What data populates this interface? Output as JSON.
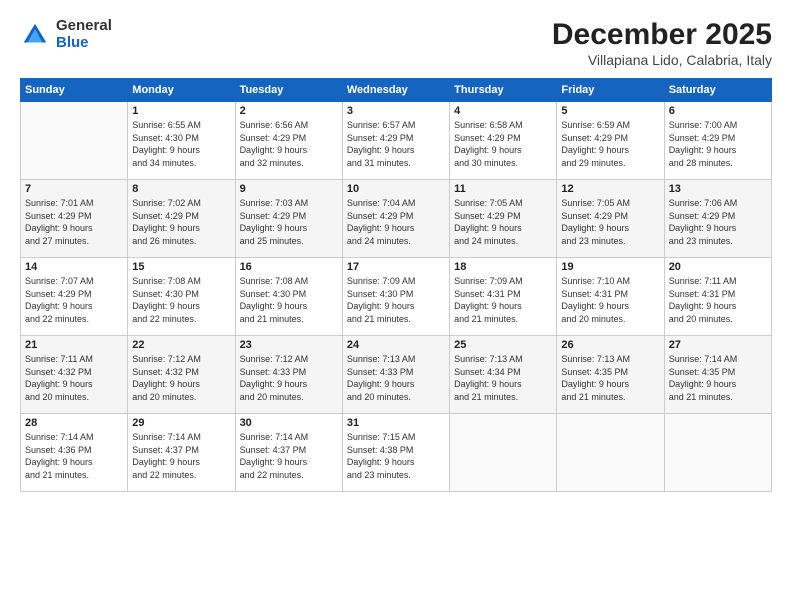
{
  "logo": {
    "general": "General",
    "blue": "Blue"
  },
  "title": "December 2025",
  "location": "Villapiana Lido, Calabria, Italy",
  "days_of_week": [
    "Sunday",
    "Monday",
    "Tuesday",
    "Wednesday",
    "Thursday",
    "Friday",
    "Saturday"
  ],
  "weeks": [
    [
      {
        "day": "",
        "sunrise": "",
        "sunset": "",
        "daylight": ""
      },
      {
        "day": "1",
        "sunrise": "Sunrise: 6:55 AM",
        "sunset": "Sunset: 4:30 PM",
        "daylight": "Daylight: 9 hours and 34 minutes."
      },
      {
        "day": "2",
        "sunrise": "Sunrise: 6:56 AM",
        "sunset": "Sunset: 4:29 PM",
        "daylight": "Daylight: 9 hours and 32 minutes."
      },
      {
        "day": "3",
        "sunrise": "Sunrise: 6:57 AM",
        "sunset": "Sunset: 4:29 PM",
        "daylight": "Daylight: 9 hours and 31 minutes."
      },
      {
        "day": "4",
        "sunrise": "Sunrise: 6:58 AM",
        "sunset": "Sunset: 4:29 PM",
        "daylight": "Daylight: 9 hours and 30 minutes."
      },
      {
        "day": "5",
        "sunrise": "Sunrise: 6:59 AM",
        "sunset": "Sunset: 4:29 PM",
        "daylight": "Daylight: 9 hours and 29 minutes."
      },
      {
        "day": "6",
        "sunrise": "Sunrise: 7:00 AM",
        "sunset": "Sunset: 4:29 PM",
        "daylight": "Daylight: 9 hours and 28 minutes."
      }
    ],
    [
      {
        "day": "7",
        "sunrise": "Sunrise: 7:01 AM",
        "sunset": "Sunset: 4:29 PM",
        "daylight": "Daylight: 9 hours and 27 minutes."
      },
      {
        "day": "8",
        "sunrise": "Sunrise: 7:02 AM",
        "sunset": "Sunset: 4:29 PM",
        "daylight": "Daylight: 9 hours and 26 minutes."
      },
      {
        "day": "9",
        "sunrise": "Sunrise: 7:03 AM",
        "sunset": "Sunset: 4:29 PM",
        "daylight": "Daylight: 9 hours and 25 minutes."
      },
      {
        "day": "10",
        "sunrise": "Sunrise: 7:04 AM",
        "sunset": "Sunset: 4:29 PM",
        "daylight": "Daylight: 9 hours and 24 minutes."
      },
      {
        "day": "11",
        "sunrise": "Sunrise: 7:05 AM",
        "sunset": "Sunset: 4:29 PM",
        "daylight": "Daylight: 9 hours and 24 minutes."
      },
      {
        "day": "12",
        "sunrise": "Sunrise: 7:05 AM",
        "sunset": "Sunset: 4:29 PM",
        "daylight": "Daylight: 9 hours and 23 minutes."
      },
      {
        "day": "13",
        "sunrise": "Sunrise: 7:06 AM",
        "sunset": "Sunset: 4:29 PM",
        "daylight": "Daylight: 9 hours and 23 minutes."
      }
    ],
    [
      {
        "day": "14",
        "sunrise": "Sunrise: 7:07 AM",
        "sunset": "Sunset: 4:29 PM",
        "daylight": "Daylight: 9 hours and 22 minutes."
      },
      {
        "day": "15",
        "sunrise": "Sunrise: 7:08 AM",
        "sunset": "Sunset: 4:30 PM",
        "daylight": "Daylight: 9 hours and 22 minutes."
      },
      {
        "day": "16",
        "sunrise": "Sunrise: 7:08 AM",
        "sunset": "Sunset: 4:30 PM",
        "daylight": "Daylight: 9 hours and 21 minutes."
      },
      {
        "day": "17",
        "sunrise": "Sunrise: 7:09 AM",
        "sunset": "Sunset: 4:30 PM",
        "daylight": "Daylight: 9 hours and 21 minutes."
      },
      {
        "day": "18",
        "sunrise": "Sunrise: 7:09 AM",
        "sunset": "Sunset: 4:31 PM",
        "daylight": "Daylight: 9 hours and 21 minutes."
      },
      {
        "day": "19",
        "sunrise": "Sunrise: 7:10 AM",
        "sunset": "Sunset: 4:31 PM",
        "daylight": "Daylight: 9 hours and 20 minutes."
      },
      {
        "day": "20",
        "sunrise": "Sunrise: 7:11 AM",
        "sunset": "Sunset: 4:31 PM",
        "daylight": "Daylight: 9 hours and 20 minutes."
      }
    ],
    [
      {
        "day": "21",
        "sunrise": "Sunrise: 7:11 AM",
        "sunset": "Sunset: 4:32 PM",
        "daylight": "Daylight: 9 hours and 20 minutes."
      },
      {
        "day": "22",
        "sunrise": "Sunrise: 7:12 AM",
        "sunset": "Sunset: 4:32 PM",
        "daylight": "Daylight: 9 hours and 20 minutes."
      },
      {
        "day": "23",
        "sunrise": "Sunrise: 7:12 AM",
        "sunset": "Sunset: 4:33 PM",
        "daylight": "Daylight: 9 hours and 20 minutes."
      },
      {
        "day": "24",
        "sunrise": "Sunrise: 7:13 AM",
        "sunset": "Sunset: 4:33 PM",
        "daylight": "Daylight: 9 hours and 20 minutes."
      },
      {
        "day": "25",
        "sunrise": "Sunrise: 7:13 AM",
        "sunset": "Sunset: 4:34 PM",
        "daylight": "Daylight: 9 hours and 21 minutes."
      },
      {
        "day": "26",
        "sunrise": "Sunrise: 7:13 AM",
        "sunset": "Sunset: 4:35 PM",
        "daylight": "Daylight: 9 hours and 21 minutes."
      },
      {
        "day": "27",
        "sunrise": "Sunrise: 7:14 AM",
        "sunset": "Sunset: 4:35 PM",
        "daylight": "Daylight: 9 hours and 21 minutes."
      }
    ],
    [
      {
        "day": "28",
        "sunrise": "Sunrise: 7:14 AM",
        "sunset": "Sunset: 4:36 PM",
        "daylight": "Daylight: 9 hours and 21 minutes."
      },
      {
        "day": "29",
        "sunrise": "Sunrise: 7:14 AM",
        "sunset": "Sunset: 4:37 PM",
        "daylight": "Daylight: 9 hours and 22 minutes."
      },
      {
        "day": "30",
        "sunrise": "Sunrise: 7:14 AM",
        "sunset": "Sunset: 4:37 PM",
        "daylight": "Daylight: 9 hours and 22 minutes."
      },
      {
        "day": "31",
        "sunrise": "Sunrise: 7:15 AM",
        "sunset": "Sunset: 4:38 PM",
        "daylight": "Daylight: 9 hours and 23 minutes."
      },
      {
        "day": "",
        "sunrise": "",
        "sunset": "",
        "daylight": ""
      },
      {
        "day": "",
        "sunrise": "",
        "sunset": "",
        "daylight": ""
      },
      {
        "day": "",
        "sunrise": "",
        "sunset": "",
        "daylight": ""
      }
    ]
  ]
}
